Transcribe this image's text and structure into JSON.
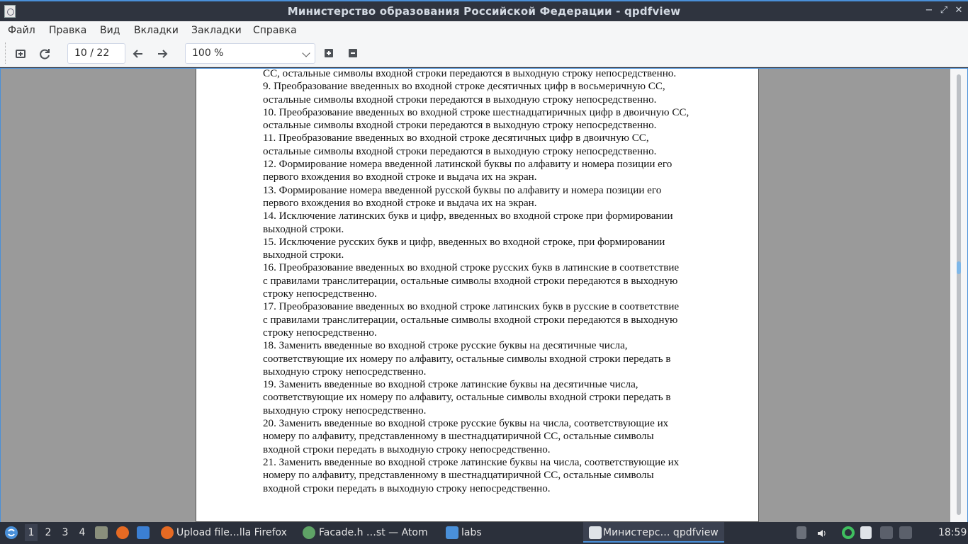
{
  "window": {
    "title": "Министерство образования Российской Федерации - qpdfview",
    "controls": {
      "minimize": "−",
      "maximize": "⤢",
      "close": "✕"
    }
  },
  "menu": [
    "Файл",
    "Правка",
    "Вид",
    "Вкладки",
    "Закладки",
    "Справка"
  ],
  "toolbar": {
    "page_field": "10 / 22",
    "zoom_value": "100 %"
  },
  "document": {
    "lines": [
      "СС,  остальные символы входной строки передаются в выходную строку  непосредственно.",
      "9. Преобразование введенных во входной строке десятичных цифр в восьмеричную СС,",
      "остальные символы входной строки передаются в выходную строку непосредственно.",
      "10. Преобразование введенных во входной строке шестнадцатиричных цифр в двоичную СС,",
      "остальные символы входной строки передаются в выходную строку непосредственно.",
      "11. Преобразование введенных во входной строке десятичных цифр в  двоичную СС,",
      "остальные символы входной строки передаются в выходную строку непосредственно.",
      "12. Формирование номера введенной латинской буквы по алфавиту и номера позиции его",
      "первого вхождения во входной строке и выдача их на экран.",
      "13. Формирование номера введенной русской буквы по алфавиту и номера позиции его",
      "первого вхождения во входной строке и выдача их на экран.",
      "14. Исключение  латинских букв и цифр, введенных во входной строке при формировании",
      "выходной строки.",
      "15. Исключение русских букв и цифр, введенных во входной строке, при формировании",
      "выходной строки.",
      "16. Преобразование введенных во входной строке русских букв в латинские в соответствие",
      "с правилами транслитерации, остальные символы входной строки передаются в выходную",
      "строку непосредственно.",
      "17. Преобразование введенных во входной строке латинских букв в русские в соответствие",
      "с правилами транслитерации, остальные символы входной строки передаются в выходную",
      "строку непосредственно.",
      "18. Заменить введенные во входной строке русские буквы на десятичные числа,",
      "соответствующие их номеру по алфавиту, остальные символы входной строки передать в",
      "выходную строку непосредственно.",
      "19. Заменить введенные во входной строке латинские буквы на десятичные числа,",
      "соответствующие их номеру по алфавиту,  остальные символы входной строки передать в",
      "выходную строку непосредственно.",
      "20. Заменить введенные во входной строке русские буквы на числа, соответствующие их",
      "номеру по алфавиту, представленному в шестнадцатиричной СС, остальные символы",
      "входной строки передать в выходную строку непосредственно.",
      "21. Заменить введенные во входной строке латинские буквы на числа, соответствующие их",
      "номеру по алфавиту, представленному в шестнадцатиричной СС, остальные символы",
      "входной строки передать в выходную строку непосредственно."
    ]
  },
  "taskbar": {
    "workspaces": [
      "1",
      "2",
      "3",
      "4"
    ],
    "tasks": [
      {
        "label": "Upload file…lla Firefox"
      },
      {
        "label": "Facade.h …st — Atom"
      },
      {
        "label": "labs"
      },
      {
        "label": "Министерс… qpdfview"
      }
    ],
    "clock": "18:59"
  }
}
